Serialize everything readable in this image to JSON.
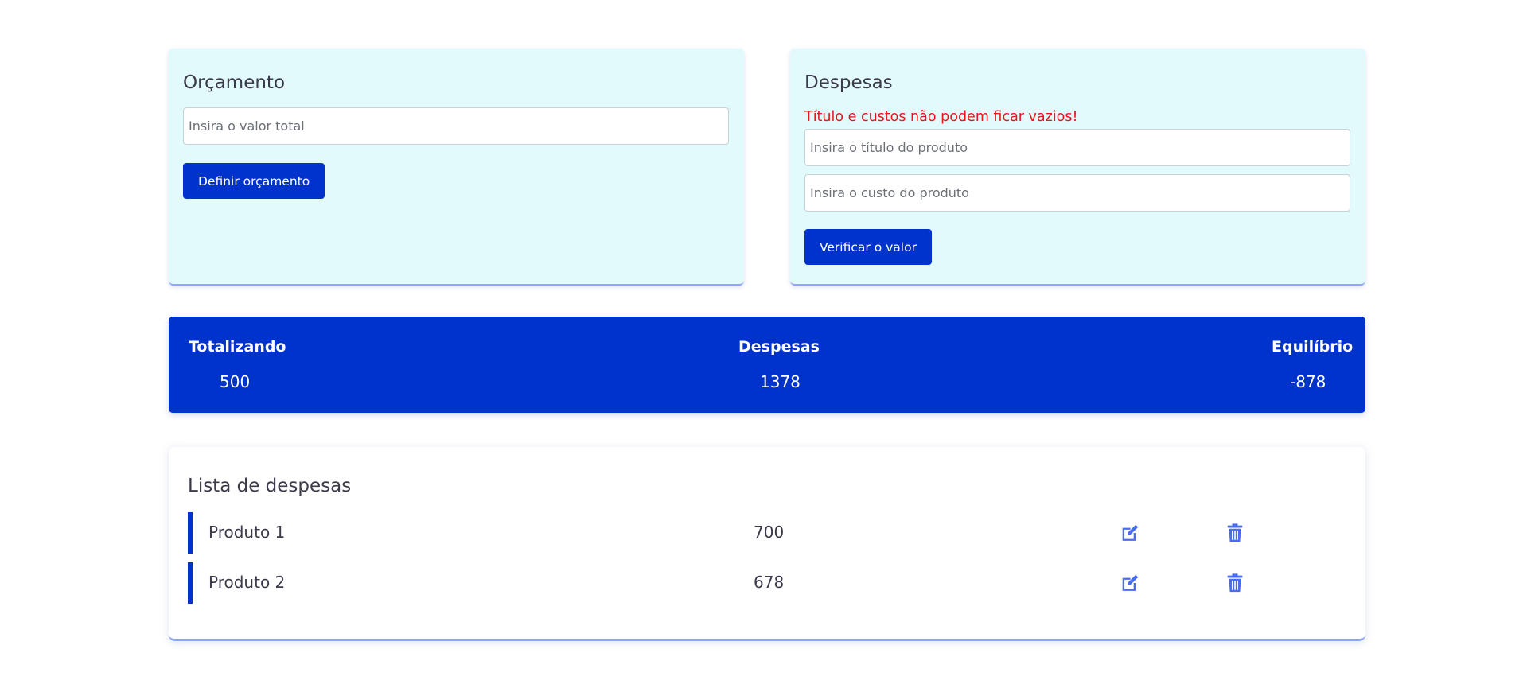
{
  "budget_card": {
    "title": "Orçamento",
    "input_placeholder": "Insira o valor total",
    "button_label": "Definir orçamento"
  },
  "expense_card": {
    "title": "Despesas",
    "error_message": "Título e custos não podem ficar vazios!",
    "title_placeholder": "Insira o título do produto",
    "cost_placeholder": "Insira o custo do produto",
    "button_label": "Verificar o valor"
  },
  "summary": {
    "total_label": "Totalizando",
    "total_value": "500",
    "expenses_label": "Despesas",
    "expenses_value": "1378",
    "balance_label": "Equilíbrio",
    "balance_value": "-878"
  },
  "expense_list": {
    "title": "Lista de despesas",
    "items": [
      {
        "name": "Produto 1",
        "cost": "700"
      },
      {
        "name": "Produto 2",
        "cost": "678"
      }
    ],
    "edit_icon": "edit-icon",
    "delete_icon": "trash-icon"
  },
  "colors": {
    "primary": "#0033cc",
    "card_bg": "#e3fafc",
    "error": "#e8141a",
    "icon": "#4a6cf0"
  }
}
